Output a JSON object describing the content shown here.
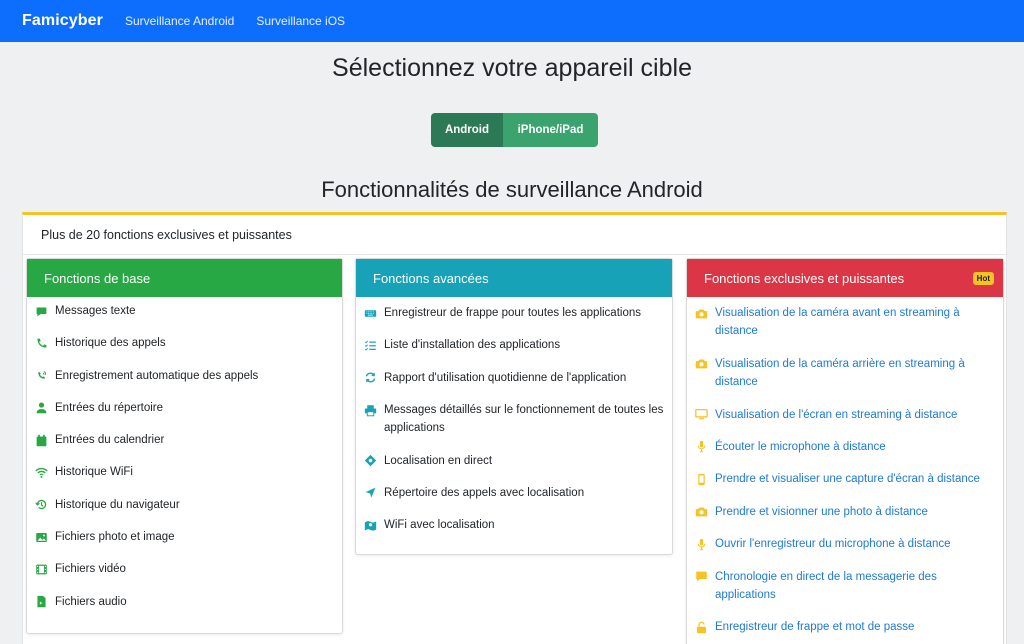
{
  "nav": {
    "brand": "Famicyber",
    "links": [
      "Surveillance Android",
      "Surveillance iOS"
    ]
  },
  "page": {
    "title": "Sélectionnez votre appareil cible",
    "toggle": {
      "android": "Android",
      "ios": "iPhone/iPad",
      "active": "android"
    },
    "section_title": "Fonctionnalités de surveillance Android",
    "panel_header": "Plus de 20 fonctions exclusives et puissantes"
  },
  "cards": {
    "basic": {
      "title": "Fonctions de base",
      "color": "#28a745",
      "items": [
        {
          "label": "Messages texte",
          "icon": "chat-icon"
        },
        {
          "label": "Historique des appels",
          "icon": "phone-icon"
        },
        {
          "label": "Enregistrement automatique des appels",
          "icon": "phone-volume-icon"
        },
        {
          "label": "Entrées du répertoire",
          "icon": "user-icon"
        },
        {
          "label": "Entrées du calendrier",
          "icon": "calendar-icon"
        },
        {
          "label": "Historique WiFi",
          "icon": "wifi-icon"
        },
        {
          "label": "Historique du navigateur",
          "icon": "history-icon"
        },
        {
          "label": "Fichiers photo et image",
          "icon": "image-icon"
        },
        {
          "label": "Fichiers vidéo",
          "icon": "film-icon"
        },
        {
          "label": "Fichiers audio",
          "icon": "audio-file-icon"
        }
      ]
    },
    "advanced": {
      "title": "Fonctions avancées",
      "color": "#17a2b8",
      "items": [
        {
          "label": "Enregistreur de frappe pour toutes les applications",
          "icon": "keyboard-icon"
        },
        {
          "label": "Liste d'installation des applications",
          "icon": "list-check-icon"
        },
        {
          "label": "Rapport d'utilisation quotidienne de l'application",
          "icon": "refresh-icon"
        },
        {
          "label": "Messages détaillés sur le fonctionnement de toutes les applications",
          "icon": "printer-icon"
        },
        {
          "label": "Localisation en direct",
          "icon": "crosshair-icon"
        },
        {
          "label": "Répertoire des appels avec localisation",
          "icon": "location-arrow-icon"
        },
        {
          "label": "WiFi avec localisation",
          "icon": "map-icon"
        }
      ]
    },
    "exclusive": {
      "title": "Fonctions exclusives et puissantes",
      "badge": "Hot",
      "color": "#dc3545",
      "items": [
        {
          "label": "Visualisation de la caméra avant en streaming à distance",
          "icon": "camera-icon"
        },
        {
          "label": "Visualisation de la caméra arrière en streaming à distance",
          "icon": "camera-icon"
        },
        {
          "label": "Visualisation de l'écran en streaming à distance",
          "icon": "desktop-icon"
        },
        {
          "label": "Écouter le microphone à distance",
          "icon": "microphone-icon"
        },
        {
          "label": "Prendre et visualiser une capture d'écran à distance",
          "icon": "mobile-icon"
        },
        {
          "label": "Prendre et visionner une photo à distance",
          "icon": "camera-icon"
        },
        {
          "label": "Ouvrir l'enregistreur du microphone à distance",
          "icon": "microphone-icon"
        },
        {
          "label": "Chronologie en direct de la messagerie des applications",
          "icon": "comment-icon"
        },
        {
          "label": "Enregistreur de frappe et mot de passe",
          "icon": "unlock-icon"
        }
      ]
    }
  }
}
